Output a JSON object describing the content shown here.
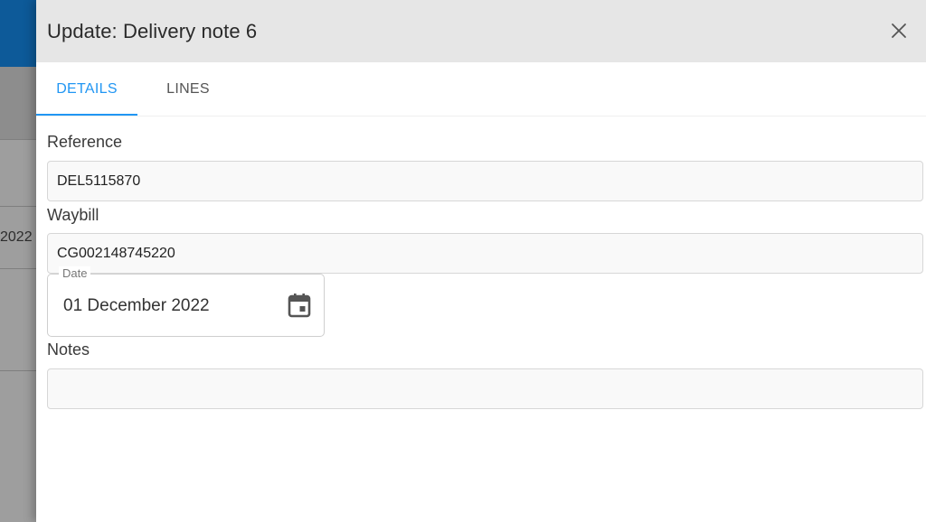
{
  "background": {
    "cell_text": "2022"
  },
  "drawer": {
    "title": "Update: Delivery note 6",
    "close_icon": "close-icon"
  },
  "tabs": [
    {
      "label": "DETAILS",
      "active": true
    },
    {
      "label": "LINES",
      "active": false
    }
  ],
  "form": {
    "reference": {
      "label": "Reference",
      "value": "DEL5115870"
    },
    "waybill": {
      "label": "Waybill",
      "value": "CG002148745220"
    },
    "date": {
      "label": "Date",
      "value": "01 December 2022",
      "icon": "calendar-icon"
    },
    "notes": {
      "label": "Notes",
      "value": ""
    }
  },
  "colors": {
    "accent": "#2196f3",
    "header_bg": "#e6e6e6",
    "app_bar": "#0d5a99"
  }
}
